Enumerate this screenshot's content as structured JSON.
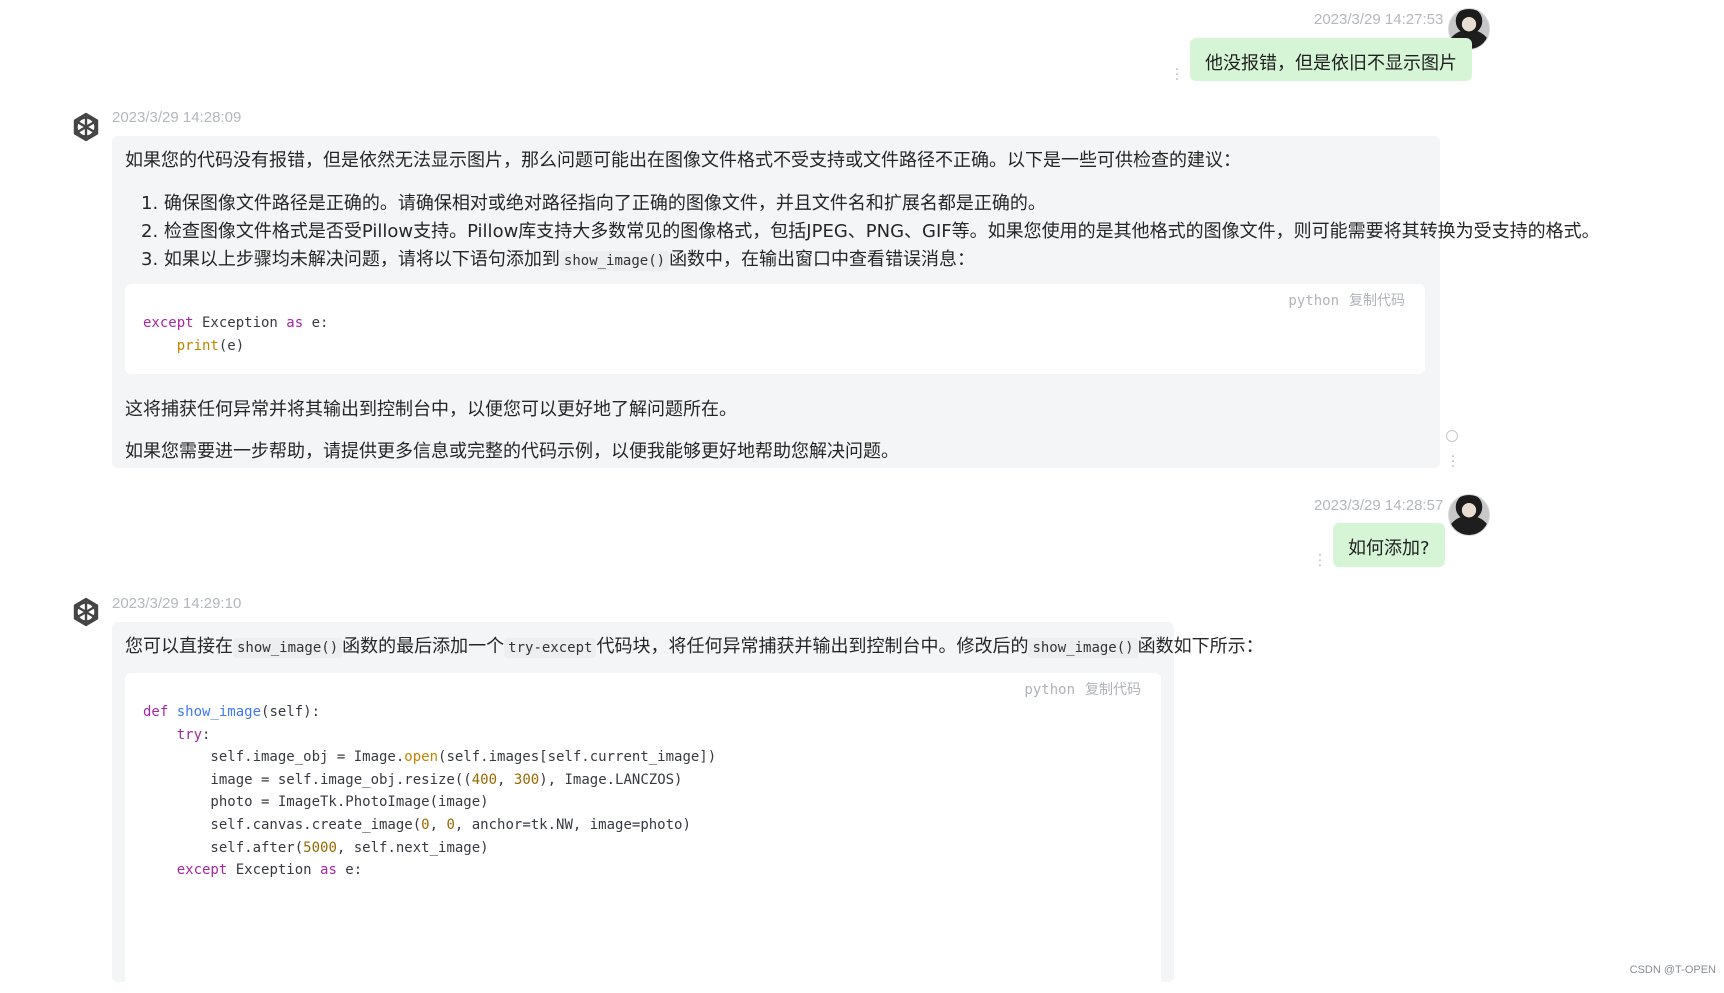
{
  "messages": [
    {
      "role": "user",
      "timestamp": "2023/3/29 14:27:53",
      "text": "他没报错，但是依旧不显示图片"
    },
    {
      "role": "assistant",
      "timestamp": "2023/3/29 14:28:09",
      "intro": "如果您的代码没有报错，但是依然无法显示图片，那么问题可能出在图像文件格式不受支持或文件路径不正确。以下是一些可供检查的建议：",
      "list": [
        "确保图像文件路径是正确的。请确保相对或绝对路径指向了正确的图像文件，并且文件名和扩展名都是正确的。",
        "检查图像文件格式是否受Pillow支持。Pillow库支持大多数常见的图像格式，包括JPEG、PNG、GIF等。如果您使用的是其他格式的图像文件，则可能需要将其转换为受支持的格式。",
        "如果以上步骤均未解决问题，请将以下语句添加到"
      ],
      "list3_code": "show_image()",
      "list3_tail": "函数中，在输出窗口中查看错误消息：",
      "code_lang": "python",
      "copy_label": "复制代码",
      "para1": "这将捕获任何异常并将其输出到控制台中，以便您可以更好地了解问题所在。",
      "para2": "如果您需要进一步帮助，请提供更多信息或完整的代码示例，以便我能够更好地帮助您解决问题。"
    },
    {
      "role": "user",
      "timestamp": "2023/3/29 14:28:57",
      "text": "如何添加?"
    },
    {
      "role": "assistant",
      "timestamp": "2023/3/29 14:29:10",
      "intro_a": "您可以直接在",
      "code_a": "show_image()",
      "intro_b": "函数的最后添加一个",
      "code_b": "try-except",
      "intro_c": "代码块，将任何异常捕获并输出到控制台中。修改后的",
      "code_c": "show_image()",
      "intro_d": "函数如下所示：",
      "code_lang": "python",
      "copy_label": "复制代码"
    }
  ],
  "watermark": "CSDN @T-OPEN"
}
